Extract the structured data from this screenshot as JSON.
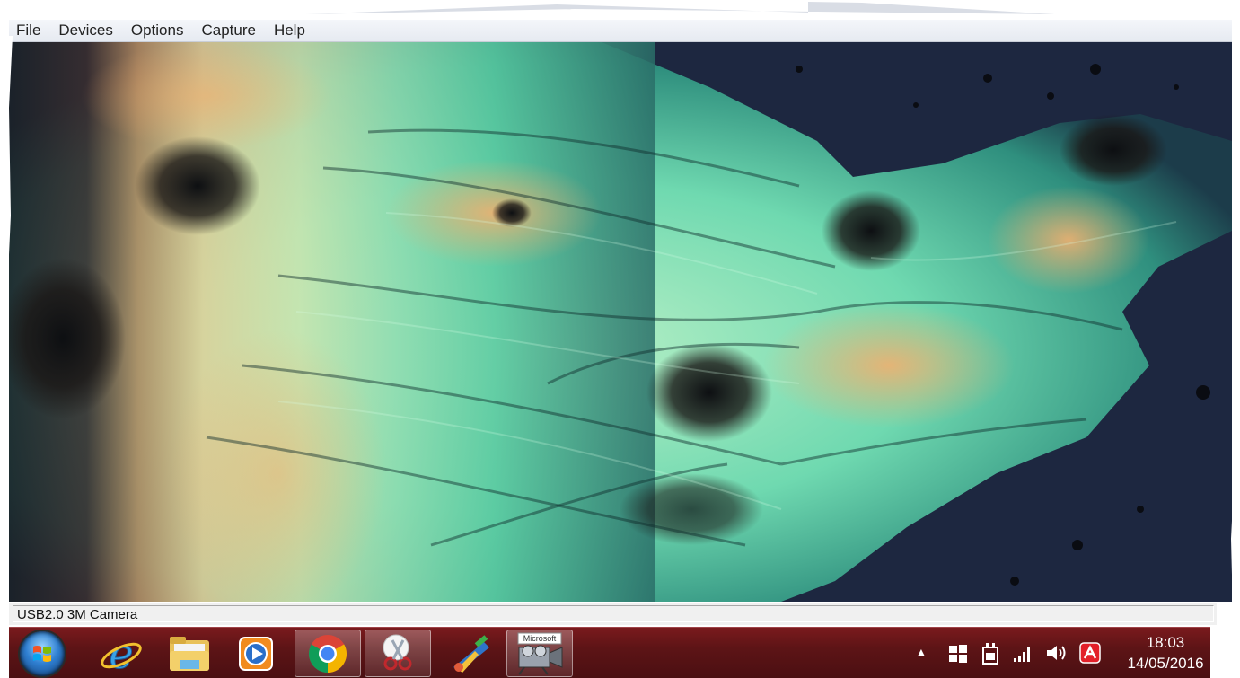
{
  "menu": {
    "items": [
      "File",
      "Devices",
      "Options",
      "Capture",
      "Help"
    ]
  },
  "status": {
    "device": "USB2.0 3M Camera"
  },
  "taskbar": {
    "pinned": [
      {
        "name": "start-button",
        "icon": "windows-orb-icon"
      },
      {
        "name": "internet-explorer",
        "icon": "internet-explorer-icon"
      },
      {
        "name": "file-explorer",
        "icon": "folder-icon"
      },
      {
        "name": "media-player",
        "icon": "media-player-icon"
      },
      {
        "name": "chrome",
        "icon": "chrome-icon"
      },
      {
        "name": "snipping-tool",
        "icon": "scissors-icon"
      },
      {
        "name": "paint-app",
        "icon": "paint-brush-icon"
      },
      {
        "name": "amcap",
        "icon": "video-camera-icon",
        "label": "Microsoft"
      }
    ],
    "tray": {
      "clock_time": "18:03",
      "clock_date": "14/05/2016",
      "icons": [
        "show-hidden-icons-arrow",
        "windows-flag-icon",
        "power-plug-icon",
        "signal-bars-icon",
        "speaker-icon",
        "avira-icon"
      ]
    }
  },
  "colors": {
    "taskbar": "#5d1416",
    "menubar": "#e9edf3",
    "preview_background": "#1c2538"
  }
}
